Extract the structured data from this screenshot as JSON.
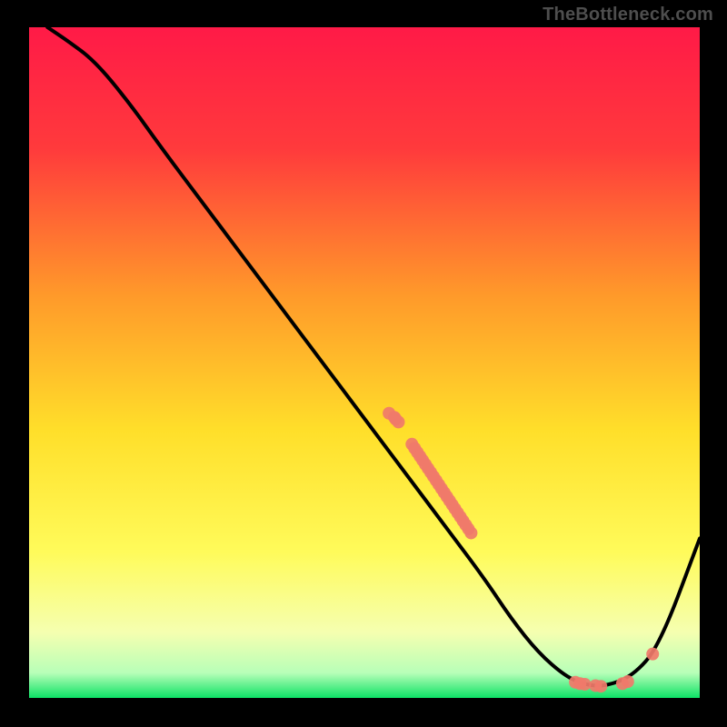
{
  "attribution": "TheBottleneck.com",
  "chart_data": {
    "type": "line",
    "title": "",
    "xlabel": "",
    "ylabel": "",
    "xlim": [
      0,
      100
    ],
    "ylim": [
      0,
      100
    ],
    "grid": false,
    "legend": false,
    "background_gradient": {
      "stops": [
        {
          "offset": 0.0,
          "color": "#ff1a47"
        },
        {
          "offset": 0.18,
          "color": "#ff3a3c"
        },
        {
          "offset": 0.4,
          "color": "#ff9a2a"
        },
        {
          "offset": 0.6,
          "color": "#ffdf2a"
        },
        {
          "offset": 0.78,
          "color": "#fffb5a"
        },
        {
          "offset": 0.9,
          "color": "#f5ffb0"
        },
        {
          "offset": 0.96,
          "color": "#b8ffb8"
        },
        {
          "offset": 1.0,
          "color": "#00e060"
        }
      ]
    },
    "curve": {
      "x": [
        3,
        6,
        10,
        15,
        20,
        26,
        32,
        38,
        44,
        50,
        56,
        62,
        68,
        72,
        76,
        80,
        83,
        86,
        90,
        94,
        100
      ],
      "y": [
        100,
        98,
        95,
        89,
        82,
        74,
        66,
        58,
        50,
        42,
        34,
        26,
        18,
        12,
        7,
        3.5,
        2.2,
        2.0,
        3.5,
        8,
        24
      ]
    },
    "marker_clusters": [
      {
        "x": [
          53.8,
          54.6,
          54.8,
          55.2
        ],
        "y": [
          42.6,
          42,
          41.7,
          41.3
        ]
      },
      {
        "x": [
          57.2,
          57.6,
          58.0,
          58.4,
          58.8,
          59.2,
          59.6,
          60.0,
          60.4,
          60.8,
          61.2,
          61.6,
          62.0,
          62.4,
          62.8,
          63.2,
          63.6,
          64.0,
          64.4,
          64.8,
          65.2,
          65.6,
          66.0
        ],
        "y": [
          38.0,
          37.4,
          36.8,
          36.2,
          35.6,
          35.0,
          34.4,
          33.8,
          33.2,
          32.6,
          32.0,
          31.4,
          30.8,
          30.2,
          29.6,
          29.0,
          28.4,
          27.8,
          27.2,
          26.6,
          26.0,
          25.4,
          24.8
        ]
      },
      {
        "x": [
          81.5,
          82.2,
          82.9,
          84.5,
          85.3,
          88.5,
          89.3,
          93.0
        ],
        "y": [
          2.6,
          2.4,
          2.3,
          2.1,
          2.0,
          2.4,
          2.7,
          6.8
        ]
      }
    ],
    "marker_style": {
      "color": "#f07a6a",
      "radius": 7
    }
  }
}
